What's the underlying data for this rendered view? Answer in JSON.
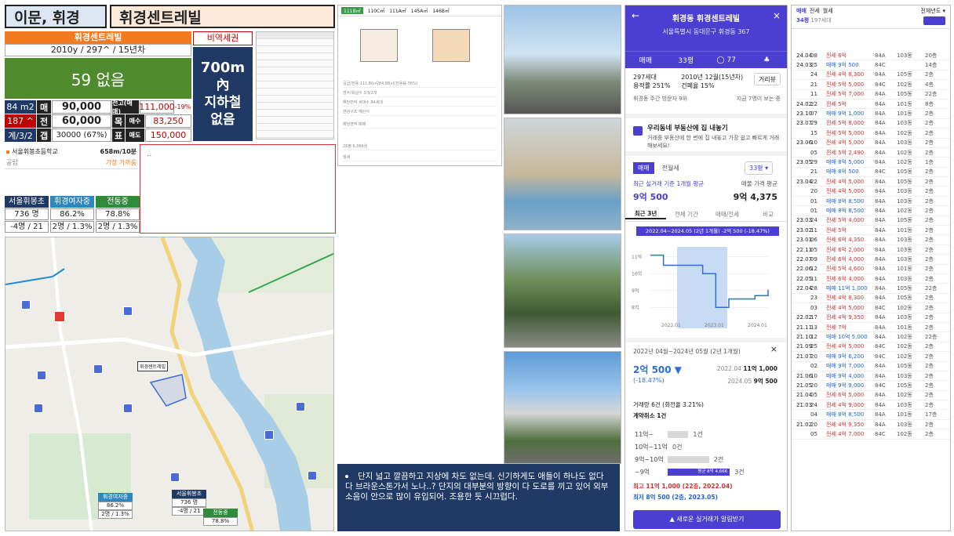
{
  "header": {
    "region": "이문, 휘경",
    "complex": "휘경센트레빌"
  },
  "summary": {
    "name": "휘경센트레빌",
    "specs": "2010y / 297^ / 15년차",
    "big_value": "59 없음",
    "tag": "비역세권",
    "subway": [
      "700m",
      "內",
      "지하철",
      "없음"
    ]
  },
  "price_grid": {
    "size": "84 m2",
    "rank": "187 ^",
    "floors": "계/3/2",
    "sale_label": "매",
    "sale_value": "90,000",
    "jeonse_label": "전",
    "jeonse_value": "60,000",
    "gap_label": "갭",
    "gap_value": "30000 (67%)",
    "prev_label": "전고(매매)",
    "prev_value": "111,000",
    "prev_change": "-19%",
    "target_label": "목",
    "buy_label": "매수",
    "buy_value": "83,250",
    "pyo_label": "표",
    "sell_label": "매도",
    "sell_value": "150,000"
  },
  "school": {
    "name": "서울휘봉초등학교",
    "distance": "658m/10분",
    "type": "공립",
    "link": "가장 가까움"
  },
  "school_tiles": [
    {
      "name": "서울휘봉초",
      "v1": "736 명",
      "v2": "-4명 / 21",
      "color": "#1f3864"
    },
    {
      "name": "휘경여자중",
      "v1": "86.2%",
      "v2": "2명 / 1.3%",
      "color": "#2e86c1"
    },
    {
      "name": "전동중",
      "v1": "78.8%",
      "v2": "2명 / 1.3%",
      "color": "#2e8b3a"
    }
  ],
  "red_box_mark": "..",
  "map": {
    "label_complex": "휘경센트레빌",
    "mini": [
      {
        "name": "휘경여자중",
        "v1": "86.2%",
        "v2": "2명 / 1.3%",
        "color": "#2e86c1"
      },
      {
        "name": "서울휘봉초",
        "v1": "736 명",
        "v2": "-4명 / 21",
        "color": "#1f3864"
      },
      {
        "name": "전동중",
        "v1": "78.8%",
        "v2": "2명 / 1.3%",
        "color": "#2e8b3a"
      }
    ]
  },
  "floorplan": {
    "tabs": [
      "111B㎡",
      "110C㎡",
      "111A㎡",
      "145A㎡",
      "146B㎡"
    ],
    "rows": [
      "공급/전용 111.80㎡/84.88㎡(전용률 76%)",
      "방수/욕실수 3개/2개",
      "해당면적 세대수 84세대",
      "현관구조 계단식",
      "해당면적 매매",
      "26평 6,066원",
      "월세"
    ]
  },
  "note": {
    "text": "단지 넓고 깔끔하고 지상에 차도 없는데. 신기하게도 애들이 하나도 없다 다 브라운스톤가서 노나..? 단지의 대부분의 방향이 다 도로를 끼고 있어 외부 소음이 안으로 많이 유입되어. 조용한 듯 시끄럽다."
  },
  "app": {
    "title": "휘경동 휘경센트레빌",
    "address": "서울특별시 동대문구 휘경동 367",
    "nav": [
      "매매",
      "33평",
      "77"
    ],
    "info1": "297세대",
    "info2": "용적률 251%",
    "info3": "2010년 12월(15년차)",
    "info4": "건폐율 15%",
    "distance_btn": "거리뷰",
    "visitors": "휘경동 주간 방문자 9위",
    "visitors_right": "지금 7명이 보는 중",
    "promo_title": "우리동네 부동산에 집 내놓기",
    "promo_body": "거래중 부동산에 한 번에 집 내놓고 가장 쉽고 빠르게 거래해보세요!",
    "tab_sale": "매매",
    "tab_jeonse": "전월세",
    "tab_size": "33평",
    "recent_label": "최근 실거래 기준 1개월 평균",
    "recent_value": "9억 500",
    "ask_label": "매물 가격 평균",
    "ask_value": "9억 4,375",
    "period_tabs": [
      "최근 3년",
      "전체 기간",
      "매매/전세",
      "비교"
    ],
    "chart_badge": "2022.04~2024.05 (2년 1개월) -2억 500 (-18.47%)",
    "range_title": "2022년 04월~2024년 05월 (2년 1개월)",
    "drop_value": "2억 500 ▼",
    "drop_pct": "(-18.47%)",
    "from_date": "2022.04",
    "from_value": "11억 1,000",
    "to_date": "2024.05",
    "to_value": "9억 500",
    "volume": "거래량 6건 (회전율 3.21%)",
    "cancel": "계약취소 1건",
    "bars": [
      {
        "label": "11억~",
        "count": "1건",
        "width": 0.22
      },
      {
        "label": "10억~11억",
        "count": "0건",
        "width": 0
      },
      {
        "label": "9억~10억",
        "count": "2건",
        "width": 0.44
      },
      {
        "label": "~9억",
        "count": "3건",
        "width": 0.66,
        "note": "평균 8억 4,666"
      }
    ],
    "max_line": "최고 11억 1,000 (22층, 2022.04)",
    "min_line": "최저 8억 500 (2층, 2023.05)",
    "cta": "새로운 실거래가 알림받기"
  },
  "chart_data": {
    "type": "line",
    "x": [
      "2022.04",
      "2022.07",
      "2022.10",
      "2023.01",
      "2023.03",
      "2023.05",
      "2023.08",
      "2023.11",
      "2024.02",
      "2024.05"
    ],
    "y": [
      11.1,
      10.5,
      10.5,
      10.5,
      10.0,
      8.0,
      8.5,
      8.5,
      8.7,
      9.05
    ],
    "ylabel": "억",
    "yticks": [
      "11억",
      "10억",
      "9억",
      "8억"
    ],
    "xticks": [
      "2022.01",
      "2023.01",
      "2024.01"
    ]
  },
  "txn": {
    "top_left": "34평",
    "top_sub": "197세대",
    "top_right": "전체년도",
    "tabs": [
      "매매",
      "전세",
      "월세"
    ],
    "rows": [
      [
        "24.04",
        "08",
        "전세 6억",
        "84A",
        "103동",
        "20층",
        "r"
      ],
      [
        "24.03",
        "25",
        "매매 9억 500",
        "84C",
        "",
        "14층",
        "b"
      ],
      [
        "",
        "24",
        "전세 4억 8,300",
        "84A",
        "105동",
        "2층",
        "r"
      ],
      [
        "",
        "21",
        "전세 5억 5,000",
        "84C",
        "102동",
        "4층",
        "r"
      ],
      [
        "",
        "11",
        "전세 5억 7,000",
        "84A",
        "105동",
        "22층",
        "r"
      ],
      [
        "24.02",
        "22",
        "전세 5억",
        "84A",
        "101동",
        "8층",
        "r"
      ],
      [
        "23.10",
        "07",
        "매매 9억 1,000",
        "84A",
        "101동",
        "2층",
        "b"
      ],
      [
        "23.07",
        "29",
        "전세 5억 8,000",
        "84A",
        "103동",
        "2층",
        "r"
      ],
      [
        "",
        "15",
        "전세 5억 5,000",
        "84A",
        "102동",
        "2층",
        "r"
      ],
      [
        "23.06",
        "10",
        "전세 4억 5,000",
        "84A",
        "103동",
        "2층",
        "r"
      ],
      [
        "",
        "05",
        "전세 5억 2,490",
        "84A",
        "102동",
        "2층",
        "r"
      ],
      [
        "23.05",
        "29",
        "매매 8억 5,000",
        "84A",
        "102동",
        "1층",
        "b"
      ],
      [
        "",
        "21",
        "매매 8억 500",
        "84C",
        "105동",
        "2층",
        "b"
      ],
      [
        "23.04",
        "22",
        "전세 4억 5,000",
        "84A",
        "105동",
        "2층",
        "r"
      ],
      [
        "",
        "20",
        "전세 4억 5,000",
        "84A",
        "103동",
        "2층",
        "r"
      ],
      [
        "",
        "01",
        "매매 8억 8,500",
        "84A",
        "103동",
        "2층",
        "b"
      ],
      [
        "",
        "01",
        "매매 8억 8,500",
        "84A",
        "102동",
        "2층",
        "b"
      ],
      [
        "23.03",
        "24",
        "전세 5억 4,000",
        "84A",
        "105동",
        "2층",
        "r"
      ],
      [
        "23.02",
        "11",
        "전세 5억",
        "84A",
        "101동",
        "2층",
        "r"
      ],
      [
        "23.01",
        "06",
        "전세 6억 4,350",
        "84A",
        "103동",
        "2층",
        "r"
      ],
      [
        "22.11",
        "05",
        "전세 6억 2,000",
        "84A",
        "103동",
        "2층",
        "r"
      ],
      [
        "22.07",
        "09",
        "전세 6억 4,000",
        "84A",
        "103동",
        "2층",
        "r"
      ],
      [
        "22.06",
        "12",
        "전세 5억 4,600",
        "84A",
        "101동",
        "2층",
        "r"
      ],
      [
        "22.05",
        "11",
        "전세 6억 4,000",
        "84A",
        "103동",
        "2층",
        "r"
      ],
      [
        "22.04",
        "28",
        "매매 11억 1,000",
        "84A",
        "105동",
        "22층",
        "b"
      ],
      [
        "",
        "23",
        "전세 4억 8,300",
        "84A",
        "105동",
        "2층",
        "r"
      ],
      [
        "",
        "03",
        "전세 4억 5,000",
        "84C",
        "102동",
        "2층",
        "r"
      ],
      [
        "22.02",
        "17",
        "전세 4억 9,350",
        "84A",
        "103동",
        "2층",
        "r"
      ],
      [
        "21.11",
        "13",
        "전세 7억",
        "84A",
        "101동",
        "2층",
        "r"
      ],
      [
        "21.10",
        "12",
        "매매 10억 5,000",
        "84A",
        "102동",
        "22층",
        "b"
      ],
      [
        "21.09",
        "25",
        "전세 4억 5,000",
        "84C",
        "102동",
        "2층",
        "r"
      ],
      [
        "21.07",
        "20",
        "매매 9억 6,200",
        "84C",
        "102동",
        "2층",
        "b"
      ],
      [
        "",
        "02",
        "매매 9억 7,000",
        "84A",
        "105동",
        "2층",
        "b"
      ],
      [
        "21.06",
        "10",
        "매매 9억 4,000",
        "84A",
        "103동",
        "2층",
        "b"
      ],
      [
        "21.05",
        "20",
        "매매 9억 9,000",
        "84C",
        "105동",
        "2층",
        "b"
      ],
      [
        "21.04",
        "05",
        "전세 6억 5,000",
        "84A",
        "102동",
        "2층",
        "r"
      ],
      [
        "21.03",
        "24",
        "전세 4억 9,000",
        "84A",
        "103동",
        "2층",
        "r"
      ],
      [
        "",
        "04",
        "매매 8억 8,500",
        "84A",
        "101동",
        "17층",
        "b"
      ],
      [
        "21.02",
        "20",
        "전세 4억 9,350",
        "84A",
        "103동",
        "2층",
        "r"
      ],
      [
        "",
        "05",
        "전세 4억 7,000",
        "84C",
        "102동",
        "2층",
        "r"
      ]
    ]
  }
}
